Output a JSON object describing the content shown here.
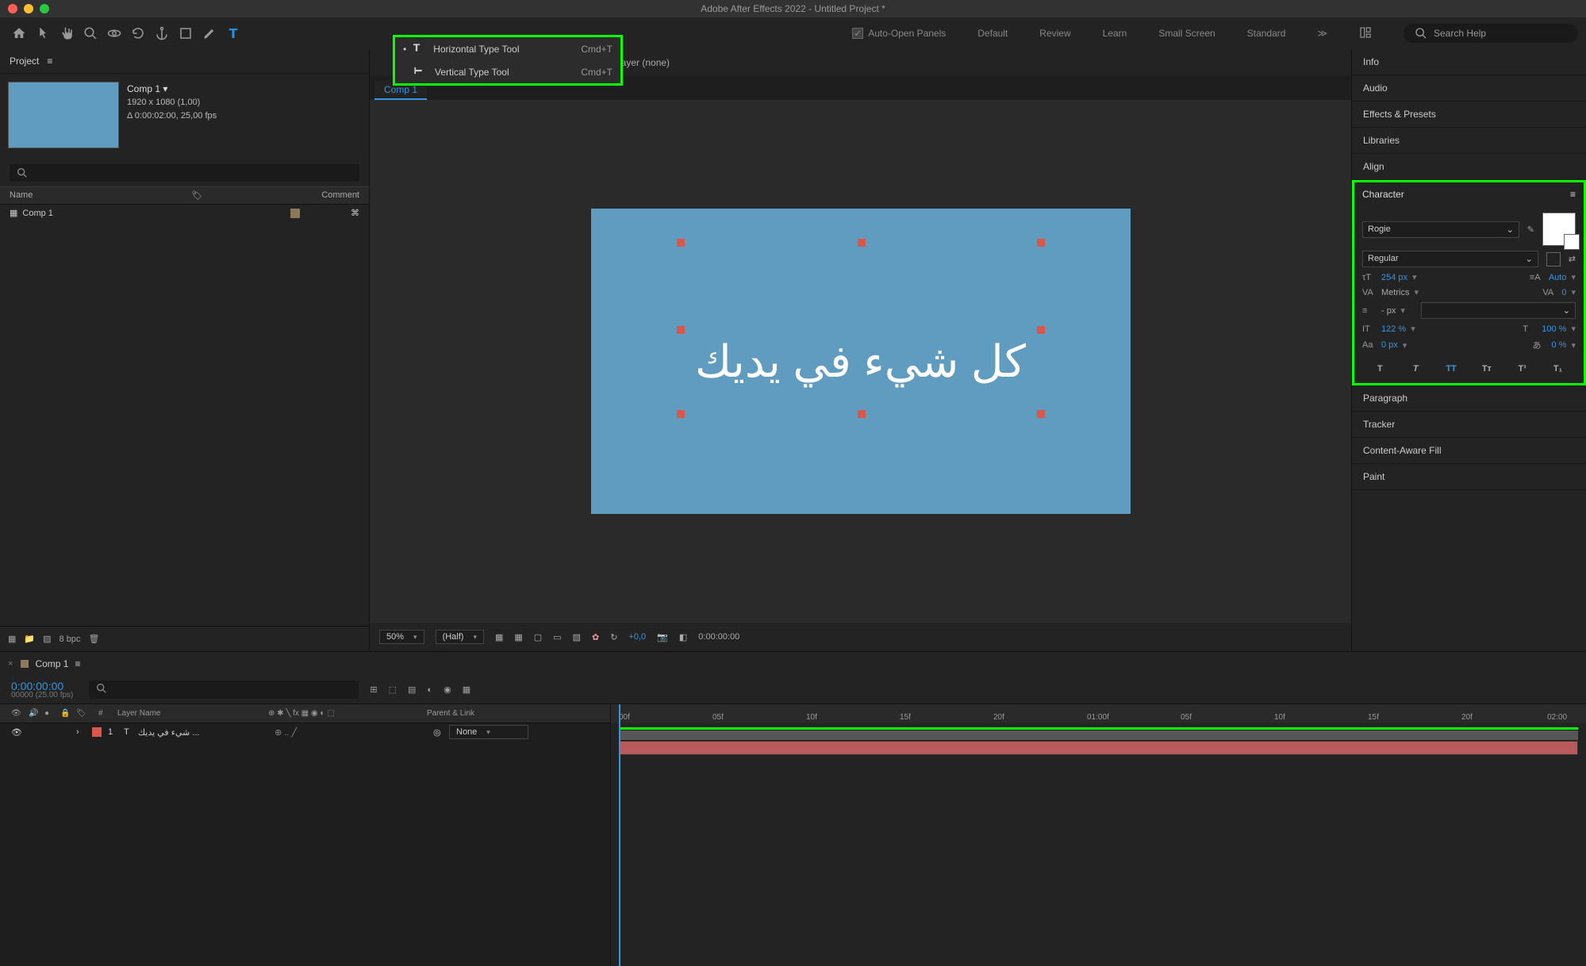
{
  "app_title": "Adobe After Effects 2022 - Untitled Project *",
  "toolbar": {
    "flyout": {
      "horizontal": "Horizontal Type Tool",
      "horizontal_shortcut": "Cmd+T",
      "vertical": "Vertical Type Tool",
      "vertical_shortcut": "Cmd+T"
    },
    "auto_open": "Auto-Open Panels",
    "workspaces": [
      "Default",
      "Review",
      "Learn",
      "Small Screen",
      "Standard"
    ],
    "search_placeholder": "Search Help"
  },
  "project": {
    "panel_title": "Project",
    "comp_name": "Comp 1 ▾",
    "resolution": "1920 x 1080 (1,00)",
    "duration": "Δ 0:00:02:00, 25,00 fps",
    "cols": {
      "name": "Name",
      "comment": "Comment"
    },
    "row_name": "Comp 1",
    "bpc": "8 bpc"
  },
  "viewer": {
    "layer_label": "Layer (none)",
    "comp_tab": "Comp 1",
    "canvas_text": "كل شيء في يديك",
    "zoom": "50%",
    "res": "(Half)",
    "exposure": "+0,0",
    "timecode": "0:00:00:00"
  },
  "right_panels": {
    "info": "Info",
    "audio": "Audio",
    "effects": "Effects & Presets",
    "libraries": "Libraries",
    "align": "Align",
    "character": {
      "title": "Character",
      "font": "Rogie",
      "style": "Regular",
      "size": "254 px",
      "leading": "Auto",
      "kerning": "Metrics",
      "tracking": "0",
      "stroke": "- px",
      "vscale": "122 %",
      "hscale": "100 %",
      "baseline": "0 px",
      "tsume": "0 %"
    },
    "paragraph": "Paragraph",
    "tracker": "Tracker",
    "content_aware": "Content-Aware Fill",
    "paint": "Paint"
  },
  "timeline": {
    "tab": "Comp 1",
    "timecode": "0:00:00:00",
    "timecode_sub": "00000 (25.00 fps)",
    "col_hash": "#",
    "col_layer": "Layer Name",
    "col_parent": "Parent & Link",
    "layer_num": "1",
    "layer_name": "... شيء في يديك",
    "parent_value": "None",
    "ruler_marks": [
      "00f",
      "05f",
      "10f",
      "15f",
      "20f",
      "01:00f",
      "05f",
      "10f",
      "15f",
      "20f",
      "02:00"
    ]
  }
}
